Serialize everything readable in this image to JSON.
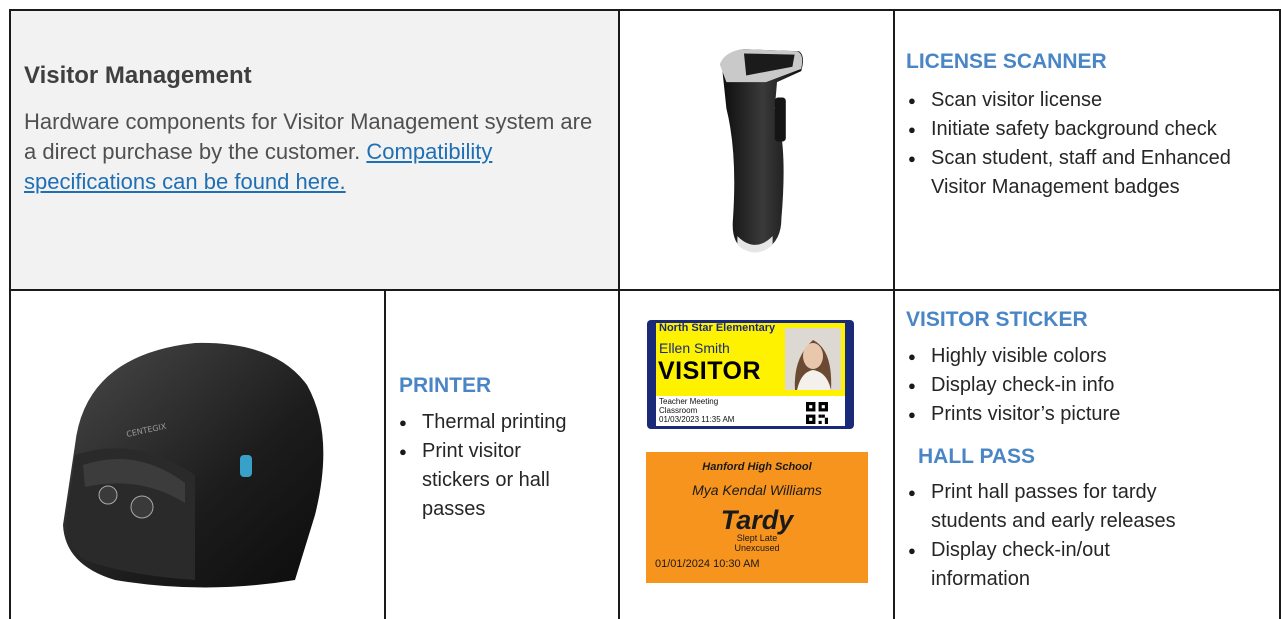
{
  "intro": {
    "title": "Visitor Management",
    "body": "Hardware components for Visitor Management system are a direct purchase by the customer.",
    "link_text": "Compatibility specifications can be found here."
  },
  "license_scanner": {
    "heading": "LICENSE SCANNER",
    "bullets": [
      "Scan visitor license",
      "Initiate safety background check",
      "Scan student, staff and Enhanced Visitor Management badges"
    ]
  },
  "printer": {
    "heading": "PRINTER",
    "bullets": [
      "Thermal printing",
      "Print visitor stickers or hall passes"
    ],
    "brand": "CENTEGIX"
  },
  "visitor_sticker": {
    "heading": "VISITOR STICKER",
    "bullets": [
      "Highly visible colors",
      "Display check-in info",
      "Prints visitor’s picture"
    ],
    "sample": {
      "school": "North Star Elementary",
      "name": "Ellen Smith",
      "word": "VISITOR",
      "reason": "Teacher Meeting",
      "location": "Classroom",
      "datetime": "01/03/2023 11:35 AM",
      "colors": {
        "band": "#fff200",
        "frame": "#1b2a78"
      }
    }
  },
  "hall_pass": {
    "heading": "HALL PASS",
    "bullets": [
      "Print hall passes for tardy students and early releases",
      "Display check-in/out information"
    ],
    "sample": {
      "school": "Hanford High School",
      "name": "Mya Kendal Williams",
      "word": "Tardy",
      "reason": "Slept Late",
      "status": "Unexcused",
      "datetime": "01/01/2024  10:30 AM",
      "colors": {
        "background": "#f7941d"
      }
    }
  },
  "colors": {
    "heading": "#4a86c5",
    "link": "#1f6fb5",
    "intro_bg": "#f2f2f2"
  }
}
